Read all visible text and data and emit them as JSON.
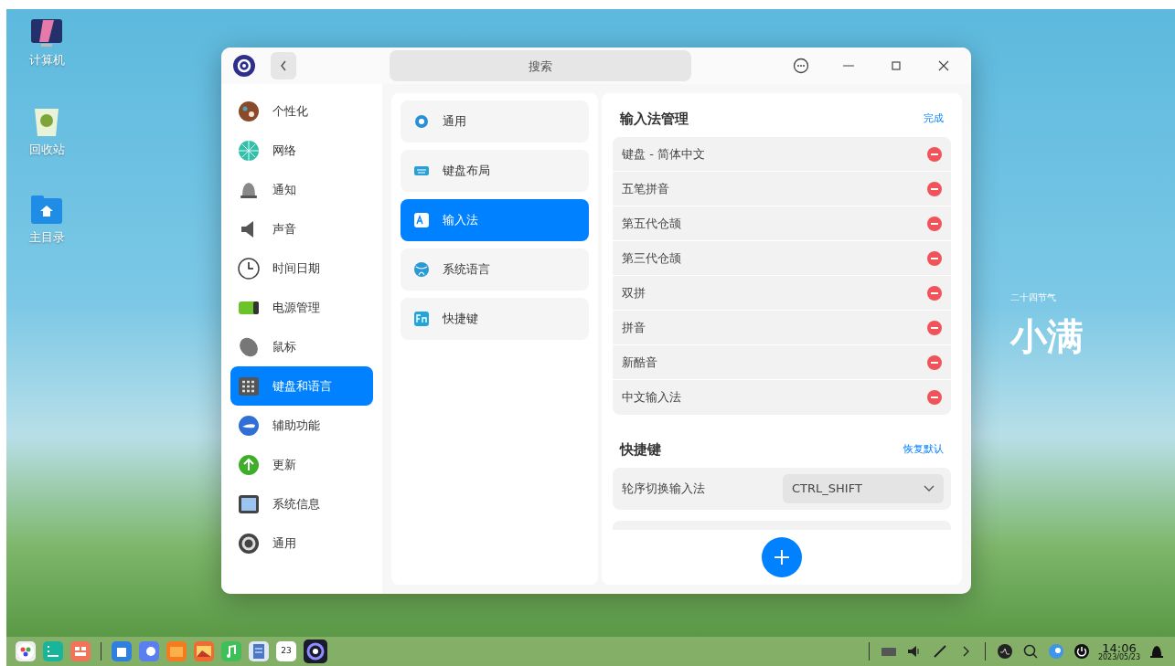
{
  "desktop_icons": [
    {
      "label": "计算机"
    },
    {
      "label": "回收站"
    },
    {
      "label": "主目录"
    }
  ],
  "wallpaper": {
    "caption": "二十四节气",
    "title": "小满"
  },
  "window": {
    "search": {
      "placeholder": "搜索"
    },
    "sidebar": {
      "items": [
        {
          "label": "个性化",
          "selected": false
        },
        {
          "label": "网络",
          "selected": false
        },
        {
          "label": "通知",
          "selected": false
        },
        {
          "label": "声音",
          "selected": false
        },
        {
          "label": "时间日期",
          "selected": false
        },
        {
          "label": "电源管理",
          "selected": false
        },
        {
          "label": "鼠标",
          "selected": false
        },
        {
          "label": "键盘和语言",
          "selected": true
        },
        {
          "label": "辅助功能",
          "selected": false
        },
        {
          "label": "更新",
          "selected": false
        },
        {
          "label": "系统信息",
          "selected": false
        },
        {
          "label": "通用",
          "selected": false
        }
      ]
    },
    "subnav": {
      "items": [
        {
          "label": "通用",
          "selected": false
        },
        {
          "label": "键盘布局",
          "selected": false
        },
        {
          "label": "输入法",
          "selected": true
        },
        {
          "label": "系统语言",
          "selected": false
        },
        {
          "label": "快捷键",
          "selected": false
        }
      ]
    },
    "input_methods": {
      "title": "输入法管理",
      "action": "完成",
      "items": [
        {
          "label": "键盘 - 简体中文"
        },
        {
          "label": "五笔拼音"
        },
        {
          "label": "第五代仓颉"
        },
        {
          "label": "第三代仓颉"
        },
        {
          "label": "双拼"
        },
        {
          "label": "拼音"
        },
        {
          "label": "新酷音"
        },
        {
          "label": "中文输入法"
        }
      ]
    },
    "shortcuts": {
      "title": "快捷键",
      "action": "恢复默认",
      "items": [
        {
          "label": "轮序切换输入法",
          "value": "CTRL_SHIFT"
        }
      ]
    }
  },
  "taskbar": {
    "calendar_day": "23",
    "clock": {
      "time": "14:06",
      "date": "2023/05/23"
    }
  }
}
